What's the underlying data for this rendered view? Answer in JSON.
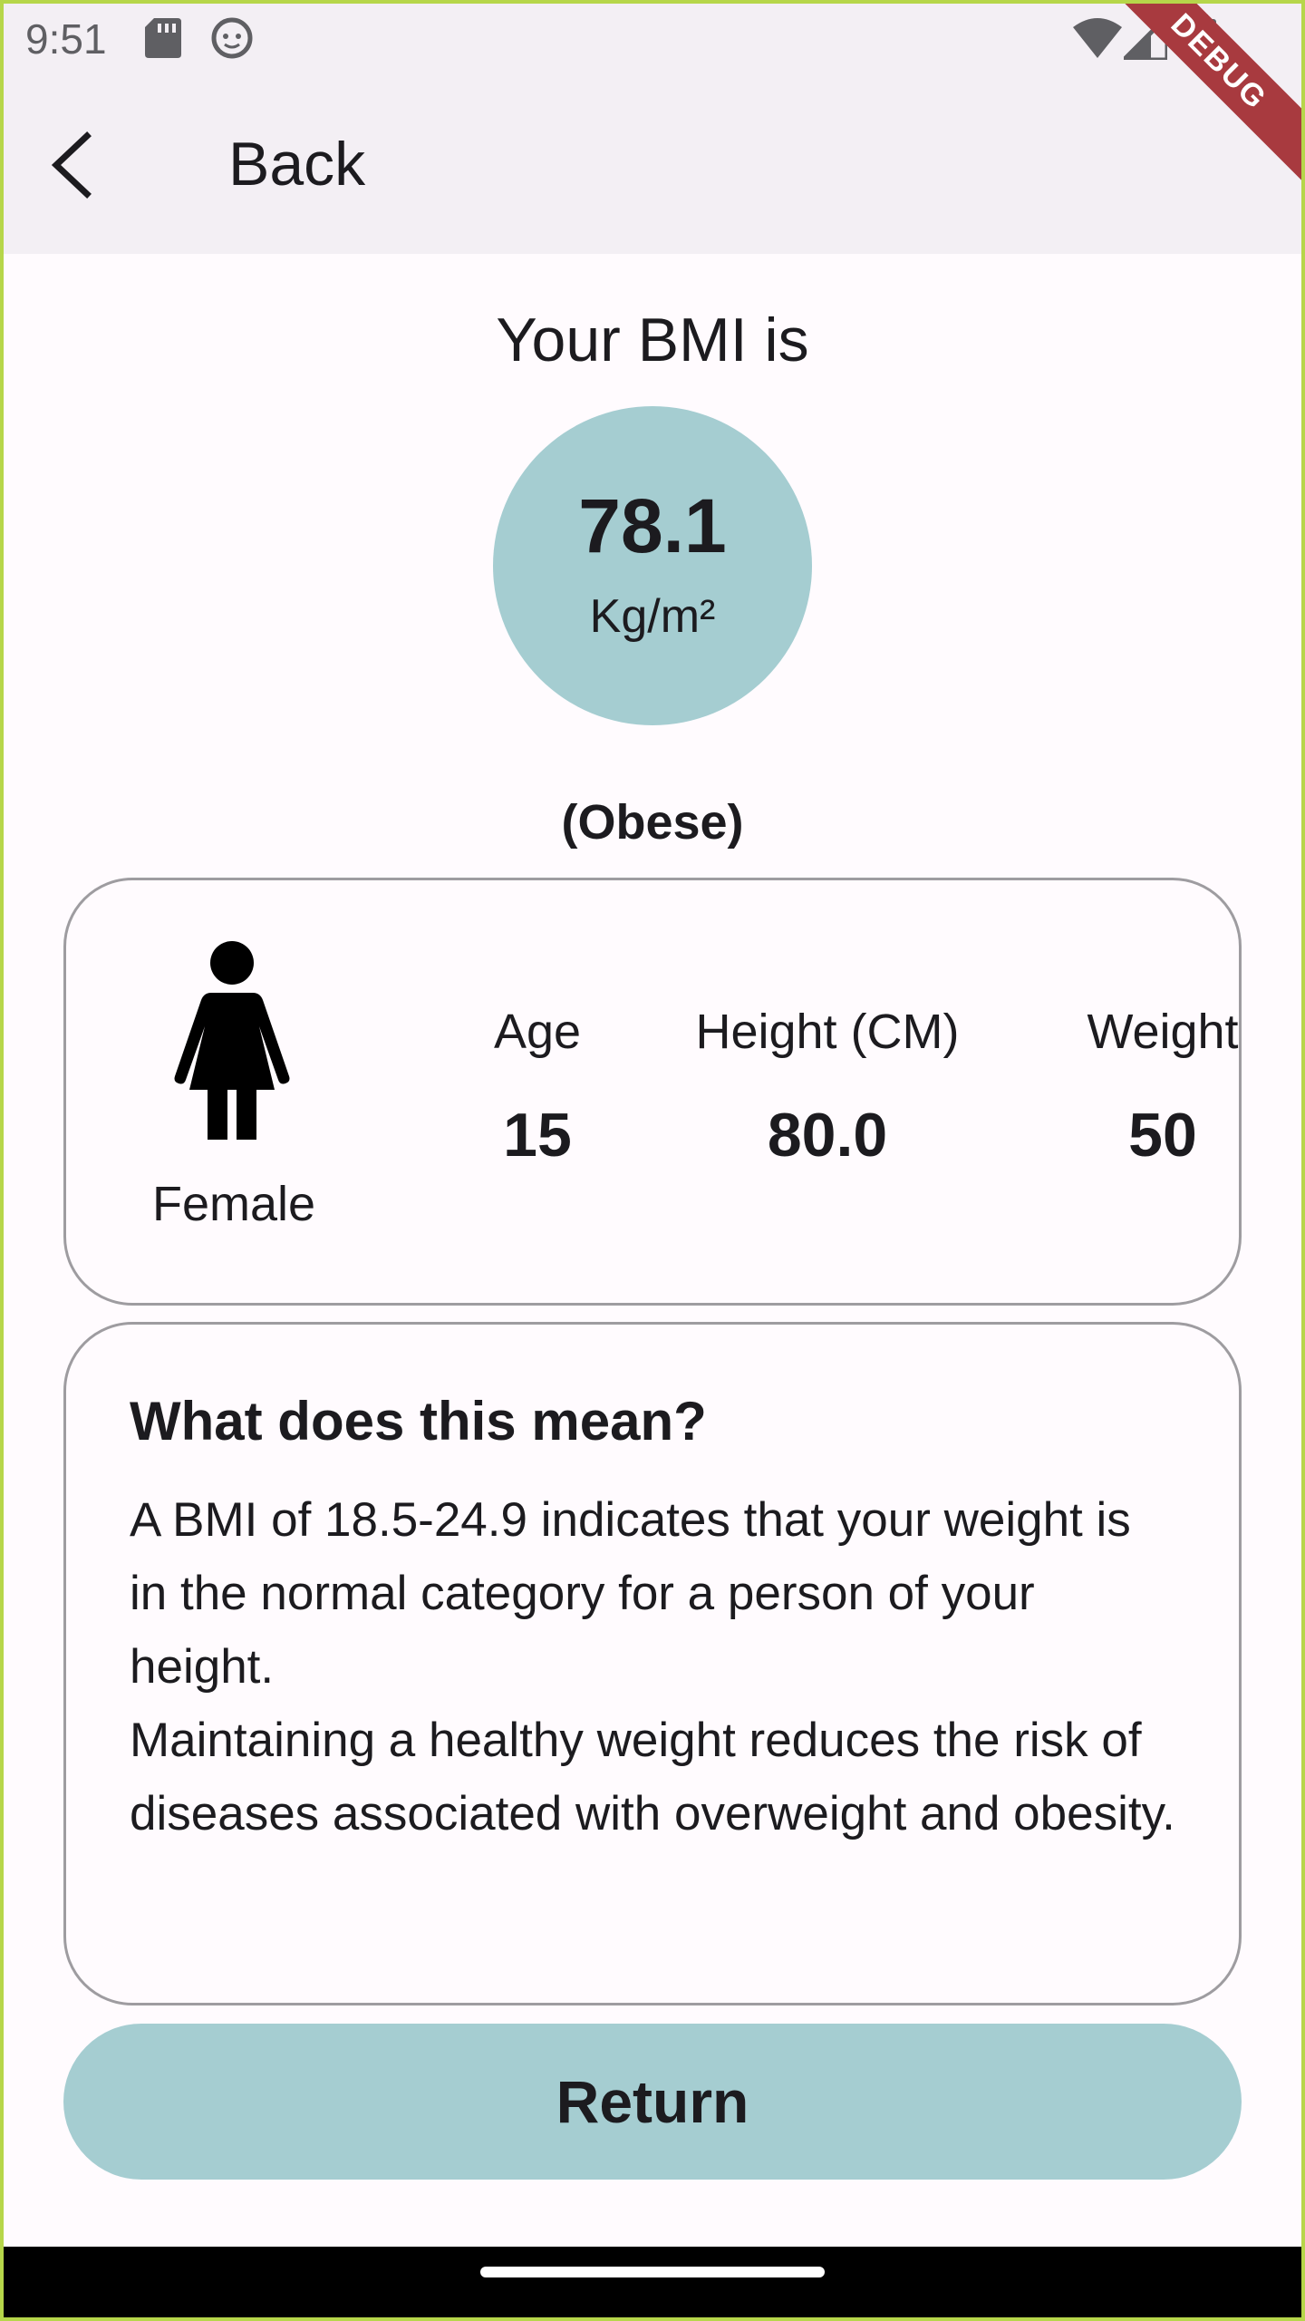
{
  "status_bar": {
    "time": "9:51",
    "icons": [
      "sd-card-icon",
      "cat-icon",
      "wifi-icon",
      "signal-icon",
      "battery-icon"
    ],
    "debug_label": "DEBUG"
  },
  "app_bar": {
    "back_icon": "chevron-left-icon",
    "title": "Back"
  },
  "result": {
    "heading": "Your BMI is",
    "value": "78.1",
    "unit": "Kg/m²",
    "category": "(Obese)",
    "circle_color": "#A5CDD1"
  },
  "profile": {
    "gender": "Female",
    "gender_icon": "female-person-icon",
    "age_label": "Age",
    "age_value": "15",
    "height_label": "Height (CM)",
    "height_value": "80.0",
    "weight_label": "Weight",
    "weight_value": "50"
  },
  "meaning": {
    "title": "What does this mean?",
    "text": "A BMI of 18.5-24.9 indicates that your weight is in the normal category for a person of your height.\n Maintaining a healthy weight reduces the risk of diseases associated with overweight and obesity."
  },
  "actions": {
    "return_label": "Return",
    "button_color": "#A5CDD1"
  }
}
